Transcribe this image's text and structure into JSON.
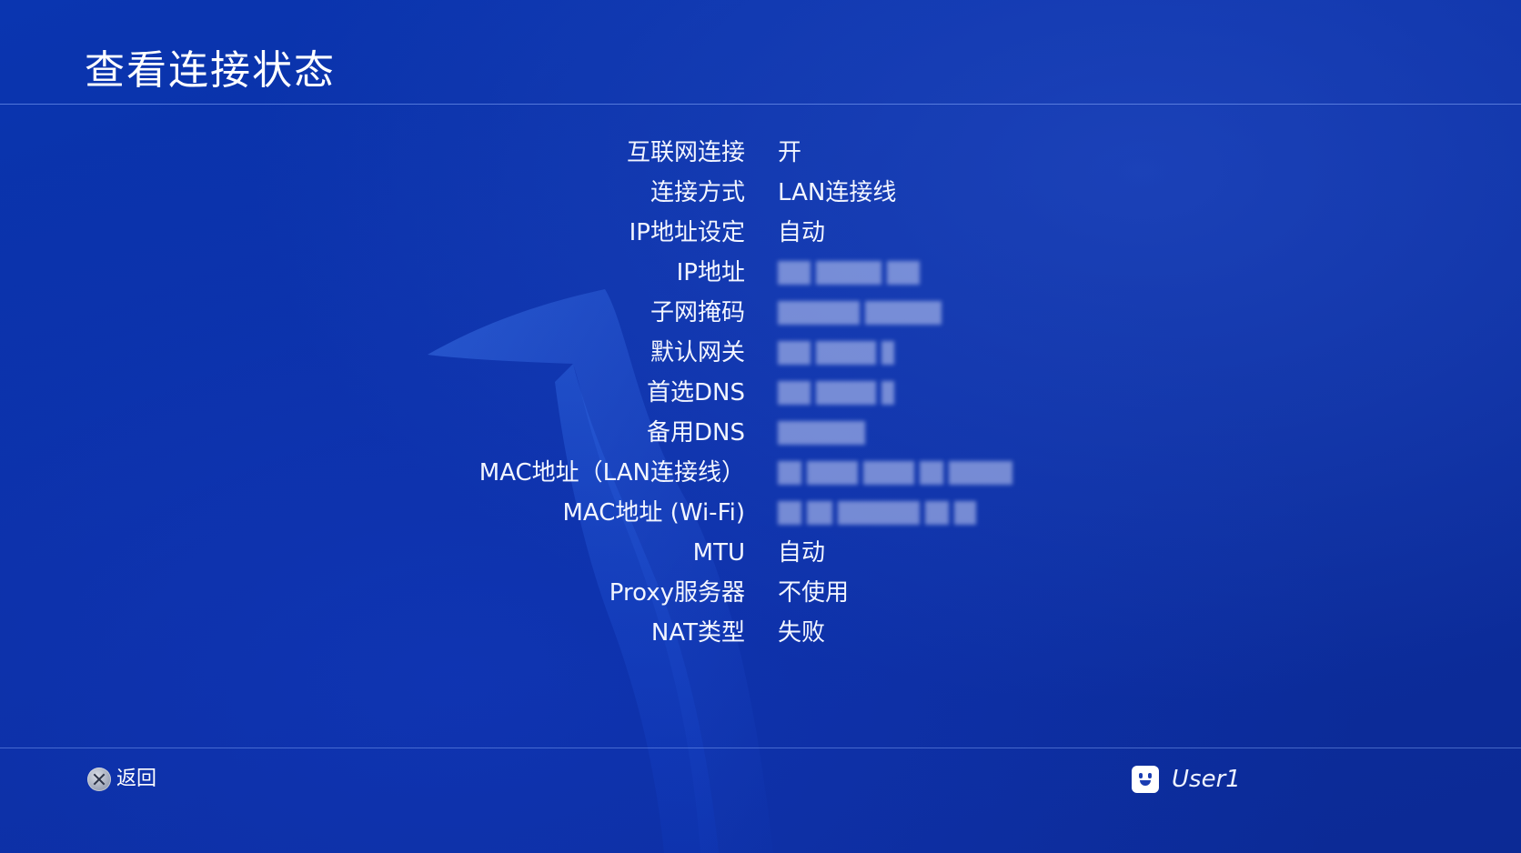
{
  "header": {
    "title": "查看连接状态"
  },
  "status": {
    "rows": [
      {
        "label": "互联网连接",
        "value": "开"
      },
      {
        "label": "连接方式",
        "value": "LAN连接线"
      },
      {
        "label": "IP地址设定",
        "value": "自动"
      },
      {
        "label": "IP地址",
        "value": ""
      },
      {
        "label": "子网掩码",
        "value": ""
      },
      {
        "label": "默认网关",
        "value": ""
      },
      {
        "label": "首选DNS",
        "value": ""
      },
      {
        "label": "备用DNS",
        "value": ""
      },
      {
        "label": "MAC地址（LAN连接线）",
        "value": ""
      },
      {
        "label": "MAC地址 (Wi-Fi)",
        "value": ""
      },
      {
        "label": "MTU",
        "value": "自动"
      },
      {
        "label": "Proxy服务器",
        "value": "不使用"
      },
      {
        "label": "NAT类型",
        "value": "失败"
      }
    ]
  },
  "footer": {
    "back_label": "返回",
    "back_icon": "cross-button-icon",
    "user_icon": "user-avatar-icon",
    "username": "User1"
  },
  "colors": {
    "background": "#0b2fa5",
    "text": "#ffffff",
    "divider": "#8cafff"
  }
}
